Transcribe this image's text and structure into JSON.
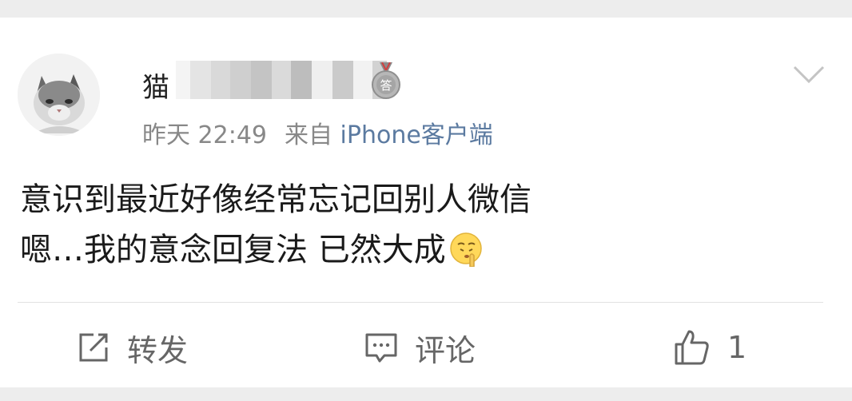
{
  "post": {
    "username_visible": "猫",
    "timestamp": "昨天 22:49",
    "source_prefix": "来自",
    "source": "iPhone客户端",
    "content_line1": "意识到最近好像经常忘记回别人微信",
    "content_line2": "嗯…我的意念回复法 已然大成"
  },
  "actions": {
    "repost_label": "转发",
    "comment_label": "评论",
    "like_count": "1"
  },
  "icons": {
    "badge": "answer-medal-icon",
    "menu": "chevron-down-icon",
    "emoji": "shush-emoji-icon",
    "repost": "repost-icon",
    "comment": "comment-icon",
    "like": "thumbs-up-icon"
  },
  "colors": {
    "background": "#ededed",
    "card": "#ffffff",
    "meta_text": "#888888",
    "source_link": "#5b7aa0",
    "content_text": "#1a1a1a"
  }
}
